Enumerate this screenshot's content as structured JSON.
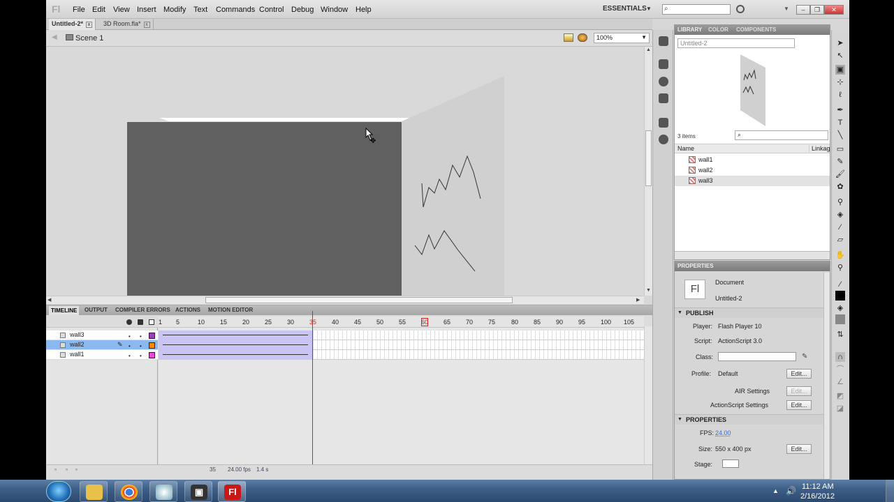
{
  "app": {
    "logo": "Fl",
    "workspace": "ESSENTIALS"
  },
  "menu": [
    "File",
    "Edit",
    "View",
    "Insert",
    "Modify",
    "Text",
    "Commands",
    "Control",
    "Debug",
    "Window",
    "Help"
  ],
  "doc_tabs": [
    {
      "label": "Untitled-2*"
    },
    {
      "label": "3D Room.fla*"
    }
  ],
  "editbar": {
    "scene": "Scene 1",
    "zoom": "100%"
  },
  "library": {
    "tabs": [
      "LIBRARY",
      "COLOR",
      "COMPONENTS"
    ],
    "document": "Untitled-2",
    "item_count": "3 items",
    "columns": {
      "name": "Name",
      "linkage": "Linkag"
    },
    "items": [
      {
        "label": "wall1"
      },
      {
        "label": "wall2"
      },
      {
        "label": "wall3"
      }
    ]
  },
  "properties": {
    "title": "PROPERTIES",
    "type": "Document",
    "doc_name": "Untitled-2",
    "publish_section": "PUBLISH",
    "player_label": "Player:",
    "player": "Flash Player 10",
    "script_label": "Script:",
    "script": "ActionScript 3.0",
    "class_label": "Class:",
    "profile_label": "Profile:",
    "profile": "Default",
    "edit": "Edit...",
    "air": "AIR Settings",
    "as_settings": "ActionScript Settings",
    "props_section": "PROPERTIES",
    "fps_label": "FPS:",
    "fps": "24.00",
    "size_label": "Size:",
    "size": "550 x 400 px",
    "stage_label": "Stage:"
  },
  "timeline": {
    "tabs": [
      "TIMELINE",
      "OUTPUT",
      "COMPILER ERRORS",
      "ACTIONS",
      "MOTION EDITOR"
    ],
    "layers": [
      {
        "name": "wall3",
        "color": "#9b3fbf"
      },
      {
        "name": "wall2",
        "color": "#ff8a00"
      },
      {
        "name": "wall1",
        "color": "#e84bd8"
      }
    ],
    "ruler": [
      "1",
      "5",
      "10",
      "15",
      "20",
      "25",
      "30",
      "35",
      "40",
      "45",
      "50",
      "55",
      "60",
      "65",
      "70",
      "75",
      "80",
      "85",
      "90",
      "95",
      "100",
      "105"
    ],
    "footer": {
      "frame": "35",
      "fps": "24.00 fps",
      "time": "1.4 s"
    }
  },
  "taskbar": {
    "time": "11:12 AM",
    "date": "2/16/2012",
    "flash_label": "Fl"
  },
  "colors": {
    "wall_front": "#606060",
    "wall_side": "#d0d0d0",
    "tween": "#c8c4f4",
    "playhead": "#dd2222"
  }
}
